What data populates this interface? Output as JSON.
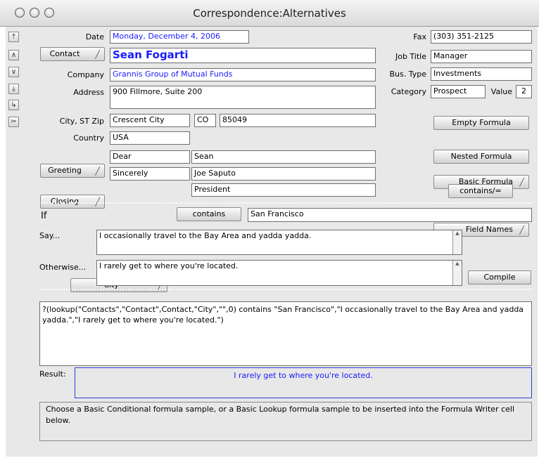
{
  "window": {
    "title": "Correspondence:Alternatives"
  },
  "nav_icons": [
    "first-record-icon",
    "previous-record-icon",
    "next-record-icon",
    "last-record-icon",
    "go-to-icon",
    "cut-icon"
  ],
  "form": {
    "date_label": "Date",
    "date_value": "Monday, December 4, 2006",
    "contact_button": "Contact",
    "contact_value": "Sean Fogarti",
    "company_label": "Company",
    "company_value": "Grannis Group of Mutual Funds",
    "address_label": "Address",
    "address_value": "900 Fillmore, Suite 200",
    "city_label": "City, ST Zip",
    "city_value": "Crescent City",
    "state_value": "CO",
    "zip_value": "85049",
    "country_label": "Country",
    "country_value": "USA",
    "greeting_button": "Greeting",
    "greeting_value": "Dear",
    "greeting_name": "Sean",
    "closing_button": "Closing",
    "closing_value": "Sincerely",
    "closing_name": "Joe Saputo",
    "closing_title": "President",
    "fax_label": "Fax",
    "fax_value": "(303) 351-2125",
    "jobtitle_label": "Job Title",
    "jobtitle_value": "Manager",
    "bustype_label": "Bus. Type",
    "bustype_value": "Investments",
    "category_label": "Category",
    "category_value": "Prospect",
    "value_label": "Value",
    "value_value": "2"
  },
  "formula_buttons": {
    "empty": "Empty Formula",
    "basic": "Basic Formula",
    "nested": "Nested Formula",
    "field_names": "Field Names",
    "contains": "contains/="
  },
  "conditional": {
    "if_label": "If",
    "field_select": "City",
    "operator_button": "contains",
    "compare_value": "San Francisco",
    "say_label": "Say...",
    "say_value": "I occasionally travel to the Bay Area and yadda yadda.",
    "otherwise_label": "Otherwise...",
    "otherwise_value": "I rarely get to where you're located.",
    "compile_button": "Compile"
  },
  "formula_text": "?(lookup(\"Contacts\",\"Contact\",Contact,\"City\",\"\",0) contains \"San Francisco\",\"I occasionally travel to the Bay Area and yadda yadda.\",\"I rarely get to where you're located.\")",
  "result": {
    "label": "Result:",
    "value": "I rarely get to where you're located."
  },
  "help_text": "Choose a Basic Conditional formula sample, or a Basic Lookup formula sample to be inserted into the Formula Writer cell below."
}
